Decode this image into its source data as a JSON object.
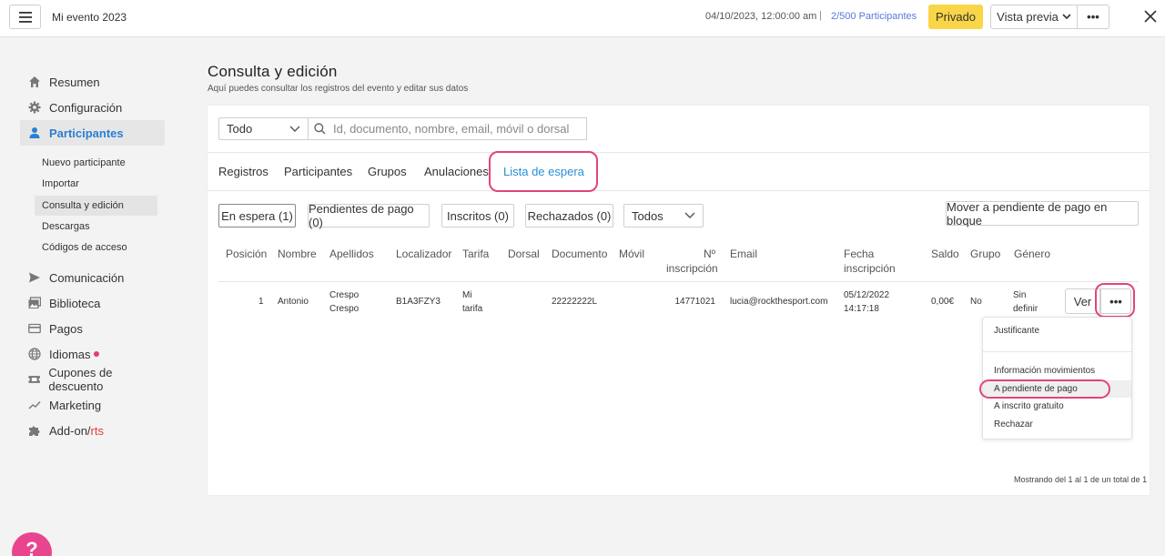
{
  "topbar": {
    "app_title": "Mi evento 2023",
    "date": "04/10/2023, 12:00:00 am",
    "separator": "|",
    "participants": "2/500 Participantes",
    "private_label": "Privado",
    "preview_label": "Vista previa",
    "more_label": "•••"
  },
  "sidebar": {
    "items": [
      {
        "label": "Resumen",
        "icon": "home-icon"
      },
      {
        "label": "Configuración",
        "icon": "gear-icon"
      },
      {
        "label": "Participantes",
        "icon": "user-icon"
      },
      {
        "label": "Comunicación",
        "icon": "send-icon"
      },
      {
        "label": "Biblioteca",
        "icon": "images-icon"
      },
      {
        "label": "Pagos",
        "icon": "card-icon"
      },
      {
        "label": "Idiomas",
        "icon": "globe-icon"
      },
      {
        "label": "Cupones de descuento",
        "icon": "ticket-icon"
      },
      {
        "label": "Marketing",
        "icon": "chart-line-icon"
      },
      {
        "label_a": "Add-on/",
        "label_b": "rts",
        "icon": "puzzle-icon"
      }
    ],
    "sub_items": [
      "Nuevo participante",
      "Importar",
      "Consulta y edición",
      "Descargas",
      "Códigos de acceso"
    ]
  },
  "main": {
    "title": "Consulta y edición",
    "subtitle": "Aquí puedes consultar los registros del evento y editar sus datos",
    "filter_value": "Todo",
    "search_placeholder": "Id, documento, nombre, email, móvil o dorsal",
    "tabs": [
      "Registros",
      "Participantes",
      "Grupos",
      "Anulaciones",
      "Lista de espera"
    ],
    "status_buttons": [
      "En espera (1)",
      "Pendientes de pago (0)",
      "Inscritos (0)",
      "Rechazados (0)"
    ],
    "todos_value": "Todos",
    "bulk_button": "Mover a pendiente de pago en bloque",
    "columns": {
      "posicion": "Posición",
      "nombre": "Nombre",
      "apellidos": "Apellidos",
      "localizador": "Localizador",
      "tarifa": "Tarifa",
      "dorsal": "Dorsal",
      "documento": "Documento",
      "movil": "Móvil",
      "n_insc_1": "Nº",
      "n_insc_2": "inscripción",
      "email": "Email",
      "fecha_1": "Fecha",
      "fecha_2": "inscripción",
      "saldo": "Saldo",
      "grupo": "Grupo",
      "genero": "Género"
    },
    "row": {
      "posicion": "1",
      "nombre": "Antonio",
      "apellidos_1": "Crespo",
      "apellidos_2": "Crespo",
      "localizador": "B1A3FZY3",
      "tarifa_1": "Mi",
      "tarifa_2": "tarifa",
      "documento": "22222222L",
      "n_insc": "14771021",
      "email": "lucia@rockthesport.com",
      "fecha_1": "05/12/2022",
      "fecha_2": "14:17:18",
      "saldo": "0,00€",
      "grupo": "No",
      "genero_1": "Sin",
      "genero_2": "definir",
      "ver_label": "Ver",
      "more_label": "•••"
    },
    "dropdown": [
      "Justificante",
      "Información movimientos",
      "A pendiente de pago",
      "A inscrito gratuito",
      "Rechazar"
    ],
    "footer": "Mostrando del 1 al 1 de un total de 1"
  },
  "help_bubble": "?",
  "colors": {
    "accent_blue": "#2a8fd4",
    "highlight_pink": "#e0457a",
    "private_yellow": "#f9d548"
  }
}
